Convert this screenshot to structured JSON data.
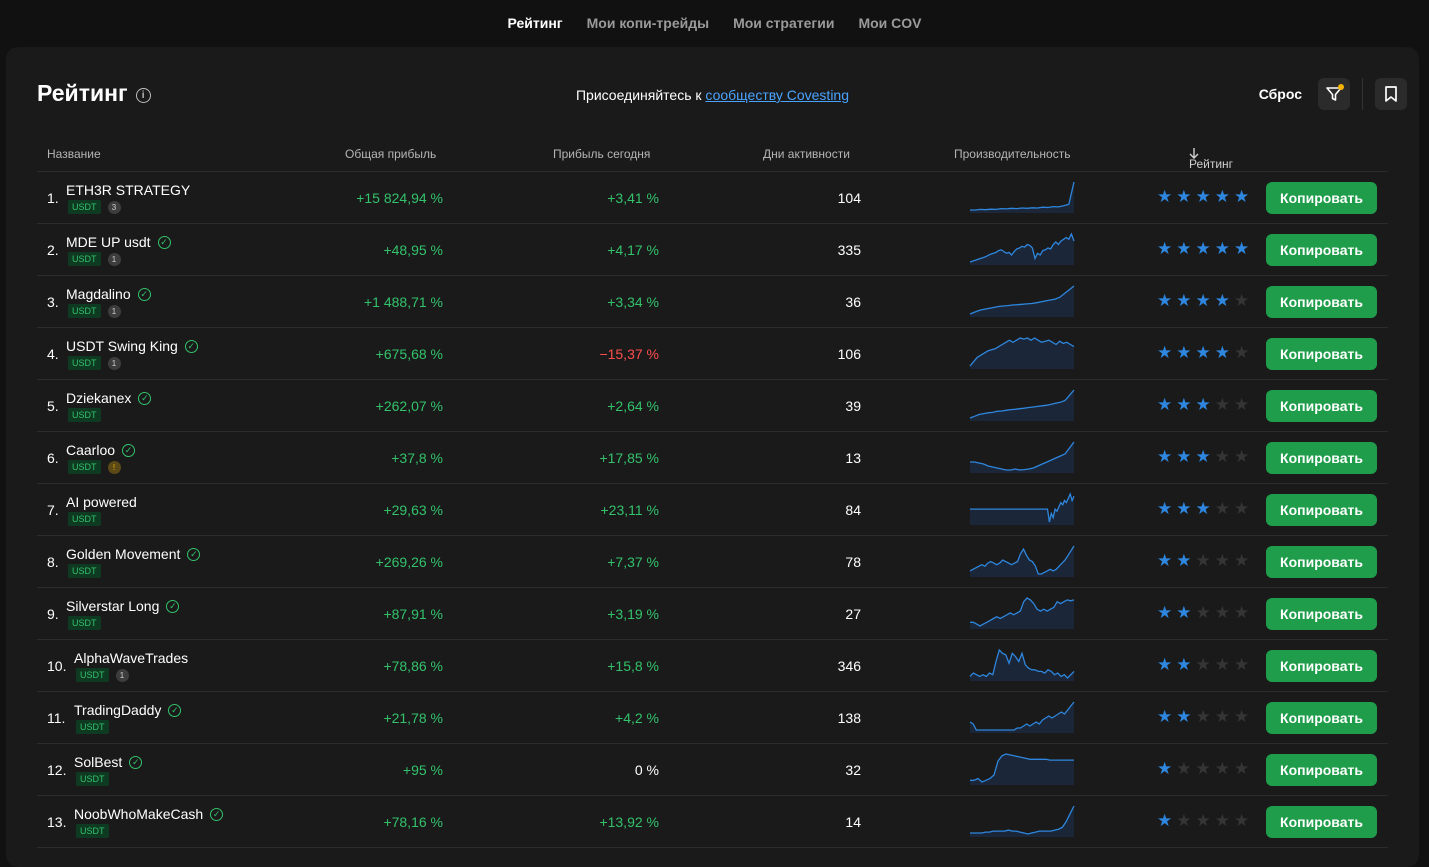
{
  "nav": {
    "tabs": [
      "Рейтинг",
      "Мои копи-трейды",
      "Мои стратегии",
      "Мои COV"
    ],
    "active": 0
  },
  "header": {
    "title": "Рейтинг",
    "join_prefix": "Присоединяйтесь к",
    "join_link": "сообществу Covesting",
    "reset_label": "Сброс"
  },
  "columns": {
    "name": "Название",
    "total_profit": "Общая прибыль",
    "today_profit": "Прибыль сегодня",
    "active_days": "Дни активности",
    "performance": "Производительность",
    "rating": "Рейтинг"
  },
  "colors": {
    "accent": "#1f9d4a",
    "positive": "#33c26b",
    "negative": "#ff4d4d",
    "star": "#2e86de",
    "link": "#4aa3ff"
  },
  "copy_label": "Копировать",
  "rows": [
    {
      "rank": "1.",
      "name": "ETH3R STRATEGY",
      "verified": false,
      "tag": "USDT",
      "badge": "3",
      "badge_type": "count",
      "total": "+15 824,94 %",
      "today": "+3,41 %",
      "today_sign": "pos",
      "days": "104",
      "stars": 5,
      "perf": [
        2,
        2,
        2.2,
        2.1,
        2.3,
        2.2,
        2.5,
        2.4,
        2.6,
        2.5,
        2.7,
        2.6,
        2.8,
        2.7,
        3,
        2.9,
        3.2,
        3.1,
        3.5,
        4,
        12
      ]
    },
    {
      "rank": "2.",
      "name": "MDE UP usdt",
      "verified": true,
      "tag": "USDT",
      "badge": "1",
      "badge_type": "count",
      "total": "+48,95 %",
      "today": "+4,17 %",
      "today_sign": "pos",
      "days": "335",
      "stars": 5,
      "perf": [
        1,
        1.5,
        2,
        2.5,
        3,
        3.5,
        4,
        4.8,
        5.5,
        6,
        6.5,
        7.5,
        8,
        7,
        6,
        6.5,
        5,
        7,
        8.5,
        9,
        10,
        9.5,
        11,
        10.5,
        9,
        3,
        6,
        5,
        7.5,
        8,
        9,
        8.5,
        11,
        12.5,
        11,
        13,
        14,
        15,
        14,
        17,
        13
      ]
    },
    {
      "rank": "3.",
      "name": "Magdalino",
      "verified": true,
      "tag": "USDT",
      "badge": "1",
      "badge_type": "count",
      "total": "+1 488,71 %",
      "today": "+3,34 %",
      "today_sign": "pos",
      "days": "36",
      "stars": 4,
      "perf": [
        1,
        2,
        3,
        3.5,
        4,
        4.5,
        5,
        5.3,
        5.5,
        5.8,
        6,
        6.2,
        6.4,
        6.6,
        7,
        7.5,
        8,
        8.5,
        9,
        10,
        12,
        14,
        16
      ]
    },
    {
      "rank": "4.",
      "name": "USDT Swing King",
      "verified": true,
      "tag": "USDT",
      "badge": "1",
      "badge_type": "count",
      "total": "+675,68 %",
      "today": "−15,37 %",
      "today_sign": "neg",
      "days": "106",
      "stars": 4,
      "perf": [
        1,
        3,
        5,
        6,
        7,
        8,
        8.5,
        9,
        10,
        11,
        12,
        13,
        12,
        13,
        14,
        13.5,
        14,
        13,
        14,
        13,
        12,
        12.5,
        13,
        12,
        11,
        12.5,
        11.5,
        12,
        11,
        10
      ]
    },
    {
      "rank": "5.",
      "name": "Dziekanex",
      "verified": true,
      "tag": "USDT",
      "badge": "",
      "badge_type": "none",
      "total": "+262,07 %",
      "today": "+2,64 %",
      "today_sign": "pos",
      "days": "39",
      "stars": 3,
      "perf": [
        1,
        2,
        3,
        3.5,
        4,
        4.2,
        4.8,
        5,
        5.4,
        5.8,
        6,
        6.3,
        6.6,
        7,
        7.3,
        7.6,
        8,
        8.3,
        8.8,
        9.5,
        10,
        11,
        14,
        17
      ]
    },
    {
      "rank": "6.",
      "name": "Caarloo",
      "verified": true,
      "tag": "USDT",
      "badge": "!",
      "badge_type": "warn",
      "total": "+37,8 %",
      "today": "+17,85 %",
      "today_sign": "pos",
      "days": "13",
      "stars": 3,
      "perf": [
        7,
        7,
        6.5,
        6,
        5,
        4.5,
        4,
        3.5,
        3,
        3,
        3.5,
        3,
        3.2,
        3.5,
        4,
        5,
        6,
        7,
        8,
        9,
        10,
        11,
        14,
        17
      ]
    },
    {
      "rank": "7.",
      "name": "AI powered",
      "verified": false,
      "tag": "USDT",
      "badge": "",
      "badge_type": "none",
      "total": "+29,63 %",
      "today": "+23,11 %",
      "today_sign": "pos",
      "days": "84",
      "stars": 3,
      "perf": [
        10,
        10,
        10,
        10,
        10,
        10,
        10,
        10,
        10,
        10,
        10,
        10,
        10,
        10,
        10,
        10,
        10,
        10,
        10,
        10,
        10,
        10,
        10,
        10,
        10,
        10,
        10,
        10,
        10,
        10,
        10,
        10,
        10,
        10,
        10,
        10,
        10,
        10,
        10,
        10,
        10,
        10,
        4,
        8,
        6,
        10,
        9,
        11,
        13,
        12,
        14,
        13,
        15,
        17,
        14,
        16
      ]
    },
    {
      "rank": "8.",
      "name": "Golden Movement",
      "verified": true,
      "tag": "USDT",
      "badge": "",
      "badge_type": "none",
      "total": "+269,26 %",
      "today": "+7,37 %",
      "today_sign": "pos",
      "days": "78",
      "stars": 2,
      "perf": [
        5,
        6,
        7,
        8,
        9,
        8,
        10,
        11,
        10,
        9,
        10,
        12,
        11,
        10,
        9,
        10,
        11,
        16,
        19,
        15,
        12,
        11,
        8,
        3,
        3,
        4,
        5,
        6,
        5,
        6,
        8,
        10,
        12,
        15,
        18,
        21
      ]
    },
    {
      "rank": "9.",
      "name": "Silverstar Long",
      "verified": true,
      "tag": "USDT",
      "badge": "",
      "badge_type": "none",
      "total": "+87,91 %",
      "today": "+3,19 %",
      "today_sign": "pos",
      "days": "27",
      "stars": 2,
      "perf": [
        5,
        5,
        4,
        3,
        4,
        5,
        6,
        7,
        8,
        7,
        8,
        9,
        10,
        9,
        10,
        11,
        16,
        18,
        17,
        15,
        12,
        11,
        12,
        11,
        12,
        13,
        16,
        15,
        16,
        17,
        16.5,
        17
      ]
    },
    {
      "rank": "10.",
      "name": "AlphaWaveTrades",
      "verified": false,
      "tag": "USDT",
      "badge": "1",
      "badge_type": "count",
      "total": "+78,86 %",
      "today": "+15,8 %",
      "today_sign": "pos",
      "days": "346",
      "stars": 2,
      "perf": [
        5,
        7,
        6,
        5,
        6,
        5,
        7,
        6,
        14,
        21,
        19,
        18,
        13,
        19,
        17,
        14,
        19,
        12,
        10,
        9,
        9,
        8,
        8,
        7,
        9,
        8,
        6,
        7,
        5,
        6,
        4,
        6,
        8
      ]
    },
    {
      "rank": "11.",
      "name": "TradingDaddy",
      "verified": true,
      "tag": "USDT",
      "badge": "",
      "badge_type": "none",
      "total": "+21,78 %",
      "today": "+4,2 %",
      "today_sign": "pos",
      "days": "138",
      "stars": 2,
      "perf": [
        9,
        8,
        5,
        5,
        5,
        5,
        5,
        5,
        5,
        5,
        5,
        5,
        5,
        5,
        5,
        6,
        6,
        7,
        8,
        7,
        8,
        9,
        8,
        10,
        11,
        12,
        11,
        12,
        13,
        14,
        13,
        15,
        17,
        19
      ]
    },
    {
      "rank": "12.",
      "name": "SolBest",
      "verified": true,
      "tag": "USDT",
      "badge": "",
      "badge_type": "none",
      "total": "+95 %",
      "today": "0 %",
      "today_sign": "neutral",
      "days": "32",
      "stars": 1,
      "perf": [
        4,
        4,
        5,
        3,
        4,
        5,
        7,
        15,
        18,
        19,
        18.5,
        18,
        17.5,
        17,
        16.5,
        16,
        16,
        16,
        16,
        16,
        15.5,
        15.5,
        15.5,
        15.5,
        15.5,
        15.5,
        15.5
      ]
    },
    {
      "rank": "13.",
      "name": "NoobWhoMakeCash",
      "verified": true,
      "tag": "USDT",
      "badge": "",
      "badge_type": "none",
      "total": "+78,16 %",
      "today": "+13,92 %",
      "today_sign": "pos",
      "days": "14",
      "stars": 1,
      "perf": [
        4,
        4,
        4,
        4,
        4.5,
        4.5,
        5,
        5,
        5,
        5,
        5.5,
        5,
        5,
        4.5,
        4,
        3.5,
        4,
        4.5,
        5,
        5,
        5,
        5,
        5.5,
        6,
        7,
        10,
        14,
        18
      ]
    }
  ]
}
